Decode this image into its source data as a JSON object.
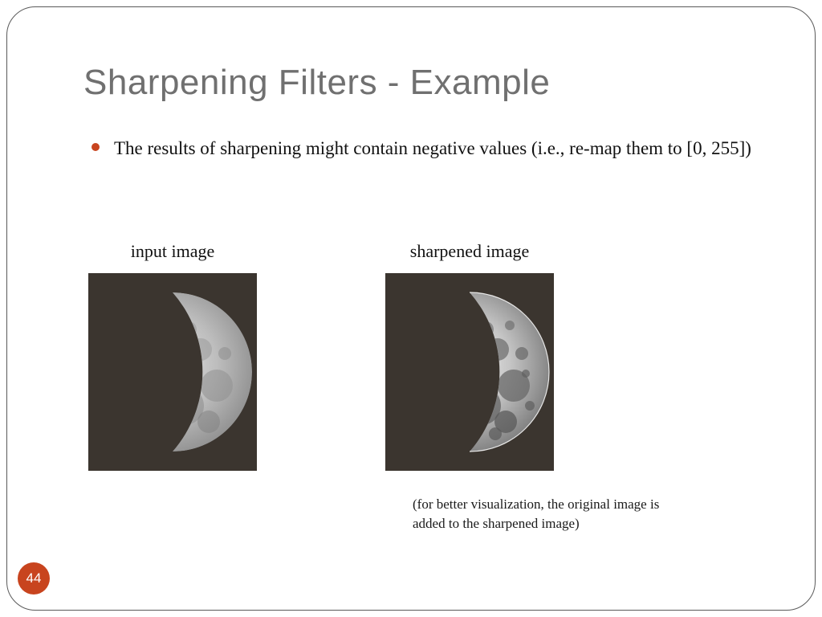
{
  "title": "Sharpening Filters - Example",
  "bullet": "The results of sharpening might contain negative values (i.e., re-map them to [0, 255])",
  "images": {
    "left": {
      "caption": "input image"
    },
    "right": {
      "caption": "sharpened image"
    }
  },
  "footnote": "(for better visualization, the original image is added to the sharpened image)",
  "page_number": "44"
}
